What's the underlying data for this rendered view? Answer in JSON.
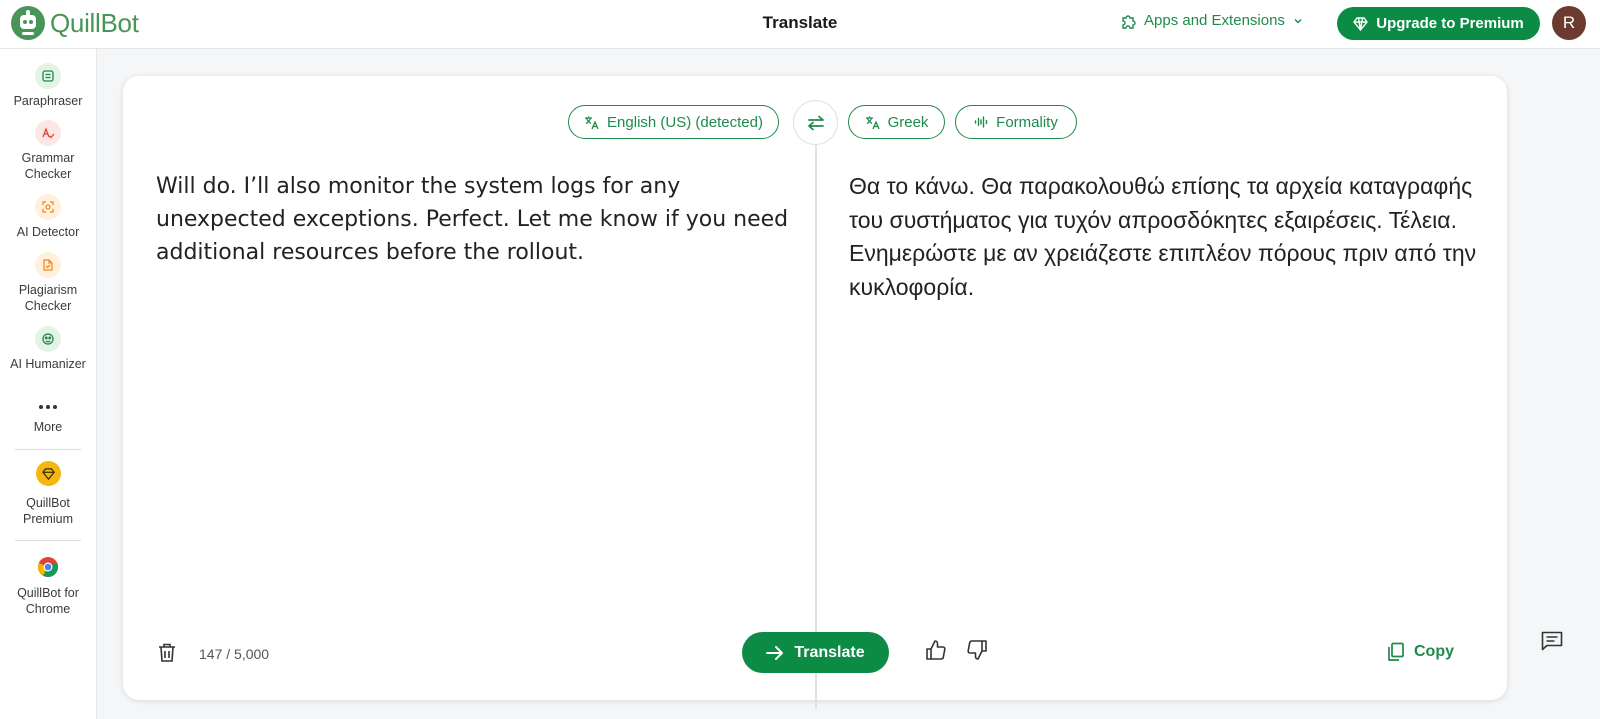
{
  "header": {
    "logo_text": "QuillBot",
    "page_title": "Translate",
    "apps_label": "Apps and Extensions",
    "upgrade_label": "Upgrade to Premium",
    "avatar_initial": "R"
  },
  "sidebar": {
    "items": [
      {
        "label": "Paraphraser",
        "icon": "paraphraser-icon"
      },
      {
        "label": "Grammar Checker",
        "icon": "grammar-checker-icon"
      },
      {
        "label": "AI Detector",
        "icon": "ai-detector-icon"
      },
      {
        "label": "Plagiarism Checker",
        "icon": "plagiarism-checker-icon"
      },
      {
        "label": "AI Humanizer",
        "icon": "ai-humanizer-icon"
      },
      {
        "label": "More",
        "icon": "more-icon"
      },
      {
        "label": "QuillBot Premium",
        "icon": "premium-diamond-icon"
      },
      {
        "label": "QuillBot for Chrome",
        "icon": "chrome-icon"
      }
    ]
  },
  "translator": {
    "source_language": "English (US) (detected)",
    "target_language": "Greek",
    "formality_label": "Formality",
    "input_text": "Will do. I’ll also monitor the system logs for any unexpected exceptions. Perfect. Let me know if you need additional resources before the rollout.",
    "output_text": "Θα το κάνω. Θα παρακολουθώ επίσης τα αρχεία καταγραφής του συστήματος για τυχόν απροσδόκητες εξαιρέσεις. Τέλεια. Ενημερώστε με αν χρειάζεστε επιπλέον πόρους πριν από την κυκλοφορία.",
    "char_count": "147 / 5,000",
    "translate_label": "Translate",
    "copy_label": "Copy"
  },
  "colors": {
    "brand_green": "#0c8b45",
    "link_green": "#1f8a4c",
    "avatar_bg": "#6a3b2e"
  }
}
